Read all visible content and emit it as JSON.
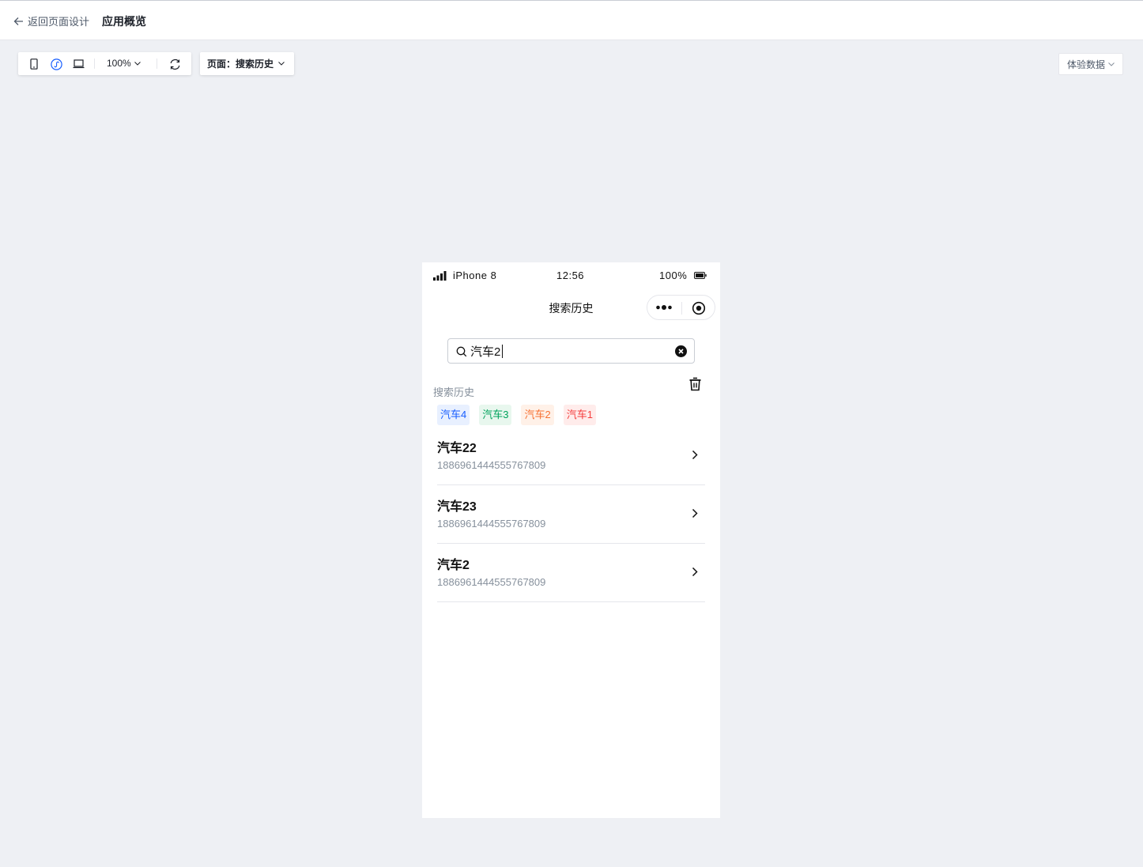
{
  "header": {
    "back_label": "返回页面设计",
    "app_title": "应用概览"
  },
  "toolbar": {
    "zoom": "100%",
    "page_label": "页面：搜索历史",
    "experience_data": "体验数据"
  },
  "phone": {
    "status": {
      "carrier": "iPhone 8",
      "time": "12:56",
      "battery": "100%"
    },
    "nav_title": "搜索历史",
    "search": {
      "value": "汽车2"
    },
    "history": {
      "label": "搜索历史",
      "tags": [
        {
          "label": "汽车4",
          "color": "#165dff",
          "bg": "#e8f0ff"
        },
        {
          "label": "汽车3",
          "color": "#00a35c",
          "bg": "#e8f7ee"
        },
        {
          "label": "汽车2",
          "color": "#f77234",
          "bg": "#fff1e8"
        },
        {
          "label": "汽车1",
          "color": "#f53f3f",
          "bg": "#ffeceb"
        }
      ]
    },
    "results": [
      {
        "title": "汽车22",
        "subtitle": "1886961444555767809"
      },
      {
        "title": "汽车23",
        "subtitle": "1886961444555767809"
      },
      {
        "title": "汽车2",
        "subtitle": "1886961444555767809"
      }
    ]
  }
}
